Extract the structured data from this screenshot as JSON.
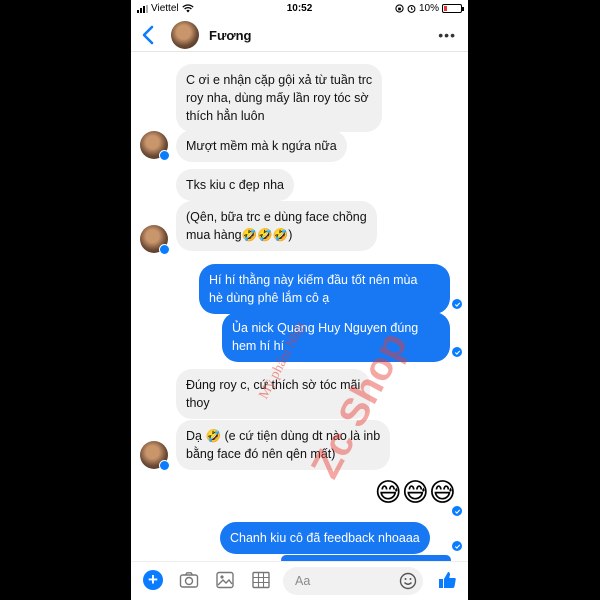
{
  "status": {
    "carrier": "Viettel",
    "time": "10:52",
    "battery": "10%",
    "battery_level": 0.1
  },
  "header": {
    "contact_name": "Fương"
  },
  "messages": {
    "m1": "C ơi e nhận cặp gội xả từ tuần trc\nroy nha, dùng mấy lần roy tóc sờ\nthích hẳn luôn",
    "m2": "Mượt mềm mà k ngứa nữa",
    "m3": "Tks kiu c đẹp nha",
    "m4": "(Qên, bữa trc e dùng face chồng\nmua hàng🤣🤣🤣)",
    "m5": "Hí hí thằng này kiếm đầu tốt nên mùa\nhè dùng phê lắm cô ạ",
    "m6": "Ủa nick Quang Huy Nguyen đúng\nhem hí hí",
    "m7": "Đúng roy c, cứ thích sờ tóc mãi\nthoy",
    "m8": "Dạ 🤣 (e cứ tiện dùng dt nào là inb\nbằng face đó nên qên mất)",
    "m9": "😅😅😅",
    "m10": "Chanh kiu cô đã feedback nhoaaa"
  },
  "watermark": {
    "line1": "Mỹ phẩm Nhật",
    "line2": "Zc Shop"
  },
  "composer": {
    "placeholder": "Aa"
  },
  "colors": {
    "accent": "#0a7cff",
    "outgoing": "#1877f2",
    "incoming": "#f1f0f0"
  }
}
